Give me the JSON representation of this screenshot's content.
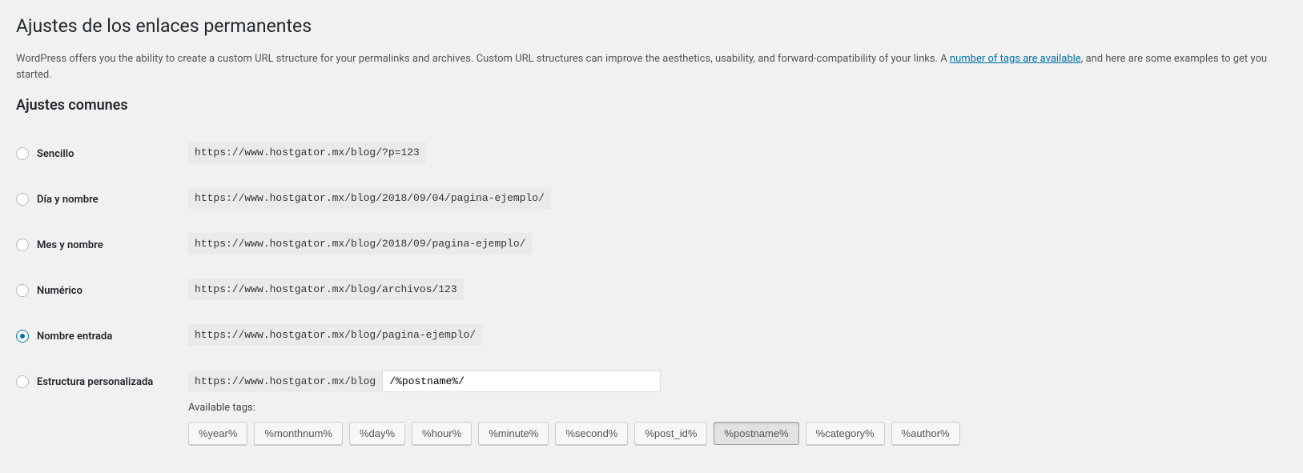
{
  "header": {
    "title": "Ajustes de los enlaces permanentes",
    "intro_before": "WordPress offers you the ability to create a custom URL structure for your permalinks and archives. Custom URL structures can improve the aesthetics, usability, and forward-compatibility of your links. A ",
    "intro_link": "number of tags are available",
    "intro_after": ", and here are some examples to get you started.",
    "section": "Ajustes comunes"
  },
  "options": {
    "plain": {
      "label": "Sencillo",
      "sample": "https://www.hostgator.mx/blog/?p=123"
    },
    "dayname": {
      "label": "Día y nombre",
      "sample": "https://www.hostgator.mx/blog/2018/09/04/pagina-ejemplo/"
    },
    "monthname": {
      "label": "Mes y nombre",
      "sample": "https://www.hostgator.mx/blog/2018/09/pagina-ejemplo/"
    },
    "numeric": {
      "label": "Numérico",
      "sample": "https://www.hostgator.mx/blog/archivos/123"
    },
    "postname": {
      "label": "Nombre entrada",
      "sample": "https://www.hostgator.mx/blog/pagina-ejemplo/"
    },
    "custom": {
      "label": "Estructura personalizada",
      "prefix": "https://www.hostgator.mx/blog",
      "value": "/%postname%/"
    }
  },
  "available_tags": {
    "label": "Available tags:",
    "items": [
      {
        "text": "%year%",
        "active": false
      },
      {
        "text": "%monthnum%",
        "active": false
      },
      {
        "text": "%day%",
        "active": false
      },
      {
        "text": "%hour%",
        "active": false
      },
      {
        "text": "%minute%",
        "active": false
      },
      {
        "text": "%second%",
        "active": false
      },
      {
        "text": "%post_id%",
        "active": false
      },
      {
        "text": "%postname%",
        "active": true
      },
      {
        "text": "%category%",
        "active": false
      },
      {
        "text": "%author%",
        "active": false
      }
    ]
  }
}
